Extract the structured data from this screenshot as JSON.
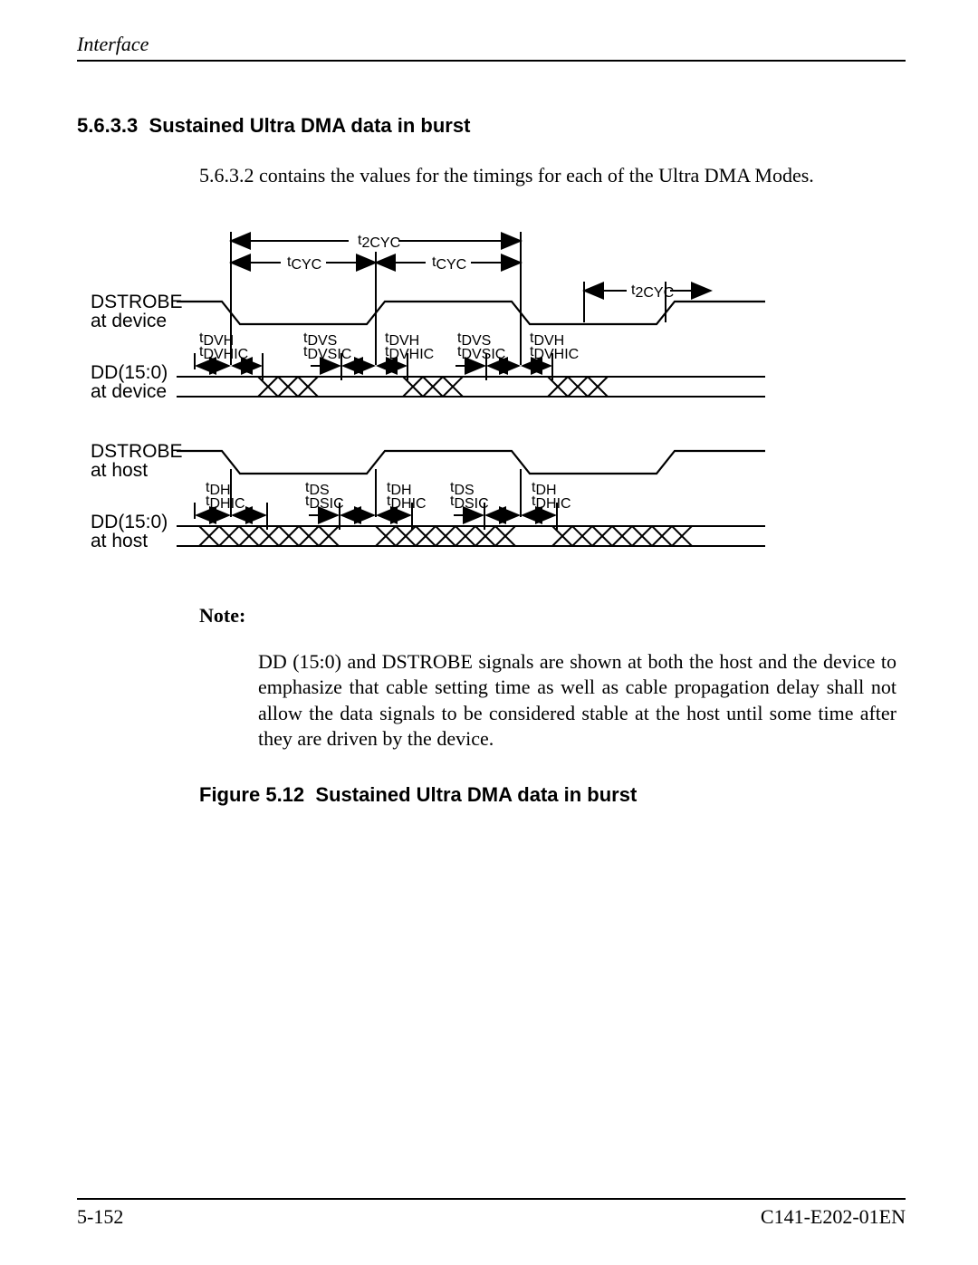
{
  "header": {
    "running": "Interface"
  },
  "section": {
    "number": "5.6.3.3",
    "title": "Sustained Ultra DMA data in burst"
  },
  "intro": "5.6.3.2 contains the values for the timings for each of the Ultra DMA Modes.",
  "diagram": {
    "signals": {
      "dstrobe_dev_a": "DSTROBE",
      "dstrobe_dev_b": "at device",
      "dd_dev_a": "DD(15:0)",
      "dd_dev_b": "at device",
      "dstrobe_host_a": "DSTROBE",
      "dstrobe_host_b": "at host",
      "dd_host_a": "DD(15:0)",
      "dd_host_b": "at host"
    },
    "labels": {
      "t2cyc": "t",
      "t2cyc_sub": "2CYC",
      "tcyc": "t",
      "tcyc_sub": "CYC",
      "tdvh": "t",
      "tdvh_sub": "DVH",
      "tdvhic": "t",
      "tdvhic_sub": "DVHIC",
      "tdvs": "t",
      "tdvs_sub": "DVS",
      "tdvsic": "t",
      "tdvsic_sub": "DVSIC",
      "tdh": "t",
      "tdh_sub": "DH",
      "tdhic": "t",
      "tdhic_sub": "DHIC",
      "tds": "t",
      "tds_sub": "DS",
      "tdsic": "t",
      "tdsic_sub": "DSIC"
    }
  },
  "note": {
    "label": "Note:",
    "body": "DD (15:0) and DSTROBE signals are shown at both the host and the device to emphasize that cable setting time as well as cable propagation delay shall not allow the data signals to be considered stable at the host until some time after they are driven by the device."
  },
  "figure": {
    "label": "Figure 5.12",
    "title": "Sustained Ultra DMA data in burst"
  },
  "footer": {
    "page": "5-152",
    "docid": "C141-E202-01EN"
  }
}
